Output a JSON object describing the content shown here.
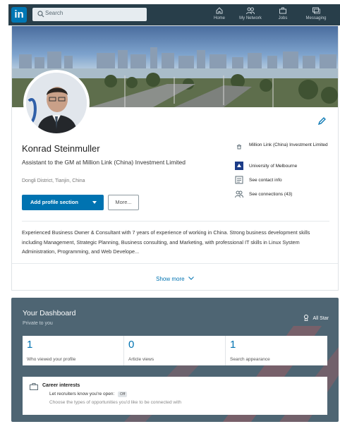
{
  "nav": {
    "logo": "in",
    "search_placeholder": "Search",
    "items": [
      {
        "label": "Home",
        "icon": "home-icon"
      },
      {
        "label": "My Network",
        "icon": "people-icon"
      },
      {
        "label": "Jobs",
        "icon": "briefcase-icon"
      },
      {
        "label": "Messaging",
        "icon": "chat-icon"
      }
    ]
  },
  "profile": {
    "name": "Konrad Steinmuller",
    "headline": "Assistant to the GM at Million Link (China) Investment Limited",
    "location": "Dongli District, Tianjin, China",
    "add_section_label": "Add profile section",
    "more_label": "More...",
    "side": [
      {
        "icon": "company-icon",
        "text": "Million Link (China) Investment Limited"
      },
      {
        "icon": "school-icon",
        "text": "University of Melbourne"
      },
      {
        "icon": "contact-card-icon",
        "text": "See contact info"
      },
      {
        "icon": "connections-icon",
        "text": "See connections (43)"
      }
    ],
    "summary": "Experienced Business Owner & Consultant with 7 years of experience of working in China. Strong business development skills including Management, Strategic Planning, Business consulting, and Marketing, with professional IT skills in Linux System Administration, Programming, and Web Develope...",
    "show_more": "Show more"
  },
  "dashboard": {
    "title": "Your Dashboard",
    "subtitle": "Private to you",
    "allstar": "All Star",
    "stats": [
      {
        "value": "1",
        "label": "Who viewed your profile"
      },
      {
        "value": "0",
        "label": "Article views"
      },
      {
        "value": "1",
        "label": "Search appearance"
      }
    ],
    "career": {
      "title": "Career interests",
      "line1": "Let recruiters know you're open:",
      "badge": "Off",
      "line2": "Choose the types of opportunities you'd like to be connected with"
    }
  },
  "colors": {
    "nav_bg": "#283e4a",
    "brand_blue": "#0073b1",
    "dashboard_bg": "#4e6573"
  }
}
